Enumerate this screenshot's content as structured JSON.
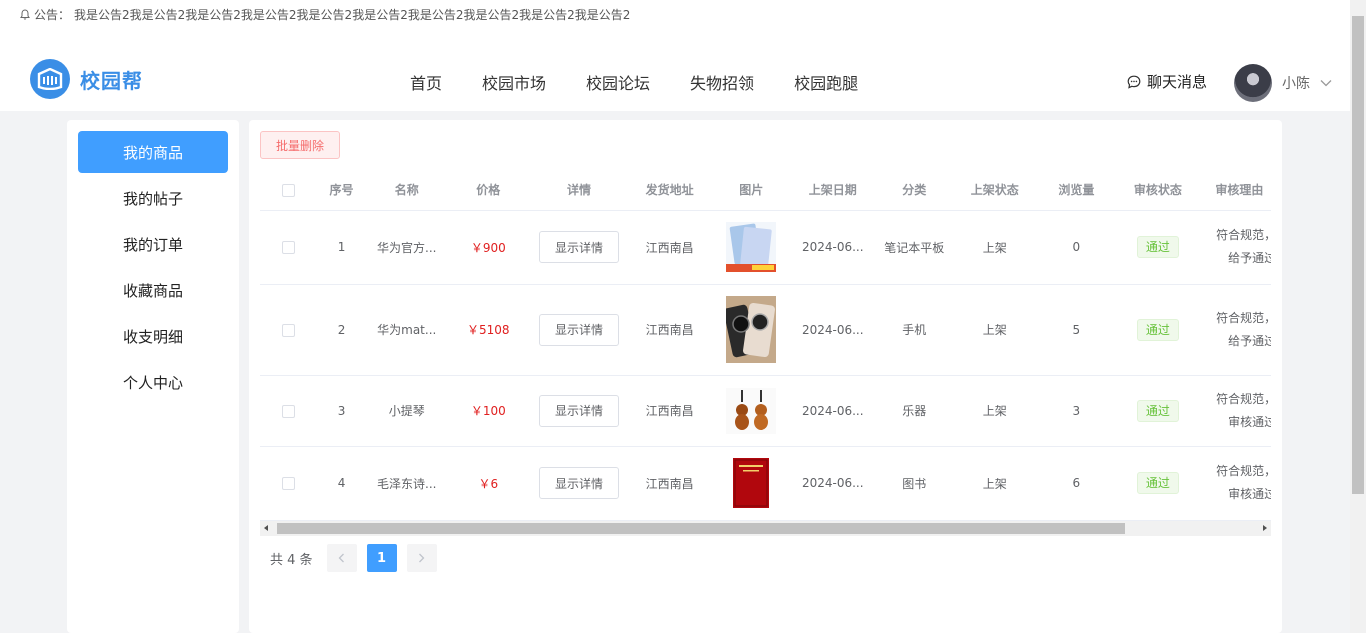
{
  "notice": {
    "label": "公告：",
    "text": "我是公告2我是公告2我是公告2我是公告2我是公告2我是公告2我是公告2我是公告2我是公告2我是公告2"
  },
  "logo": {
    "text": "校园帮"
  },
  "nav": {
    "items": [
      "首页",
      "校园市场",
      "校园论坛",
      "失物招领",
      "校园跑腿"
    ]
  },
  "chat": {
    "label": "聊天消息"
  },
  "user": {
    "name": "小陈"
  },
  "sidebar": {
    "items": [
      "我的商品",
      "我的帖子",
      "我的订单",
      "收藏商品",
      "收支明细",
      "个人中心"
    ],
    "active": 0
  },
  "toolbar": {
    "batch_delete": "批量删除"
  },
  "table": {
    "headers": [
      "序号",
      "名称",
      "价格",
      "详情",
      "发货地址",
      "图片",
      "上架日期",
      "分类",
      "上架状态",
      "浏览量",
      "审核状态",
      "审核理由"
    ],
    "detail_label": "显示详情",
    "rows": [
      {
        "index": "1",
        "name": "华为官方...",
        "price": "￥900",
        "address": "江西南昌",
        "image": "tablet-image",
        "date": "2024-06...",
        "category": "笔记本平板",
        "status": "上架",
        "views": "0",
        "audit": "通过",
        "reason_1": "符合规范，",
        "reason_2": "给予通过"
      },
      {
        "index": "2",
        "name": "华为mat...",
        "price": "￥5108",
        "address": "江西南昌",
        "image": "phone-image",
        "date": "2024-06...",
        "category": "手机",
        "status": "上架",
        "views": "5",
        "audit": "通过",
        "reason_1": "符合规范，",
        "reason_2": "给予通过"
      },
      {
        "index": "3",
        "name": "小提琴",
        "price": "￥100",
        "address": "江西南昌",
        "image": "violin-image",
        "date": "2024-06...",
        "category": "乐器",
        "status": "上架",
        "views": "3",
        "audit": "通过",
        "reason_1": "符合规范，",
        "reason_2": "审核通过"
      },
      {
        "index": "4",
        "name": "毛泽东诗...",
        "price": "￥6",
        "address": "江西南昌",
        "image": "book-image",
        "date": "2024-06...",
        "category": "图书",
        "status": "上架",
        "views": "6",
        "audit": "通过",
        "reason_1": "符合规范，",
        "reason_2": "审核通过"
      }
    ]
  },
  "pagination": {
    "total": "共 4 条",
    "current": "1"
  },
  "colors": {
    "primary": "#409eff",
    "price": "#e02020",
    "pass": "#67c23a",
    "danger": "#f56c6c"
  }
}
